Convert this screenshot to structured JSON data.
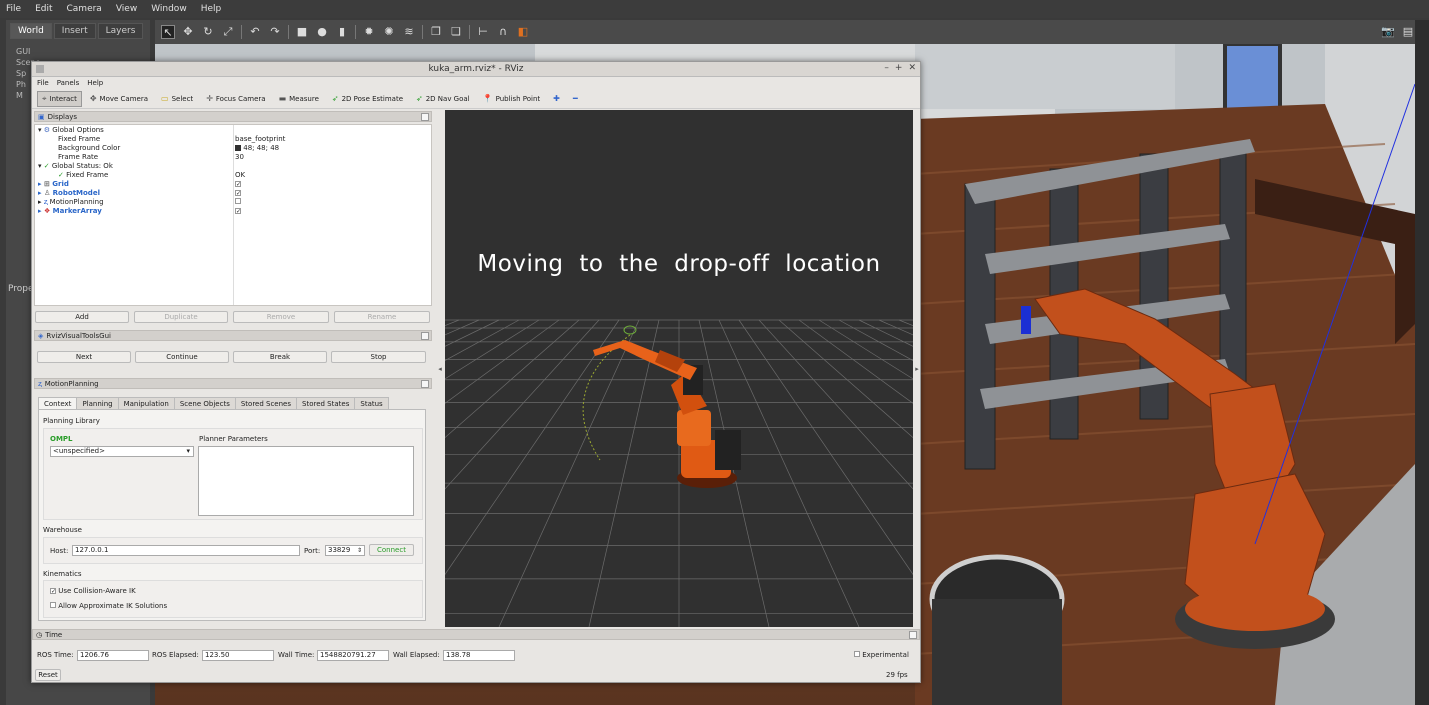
{
  "gazebo": {
    "menu": [
      "File",
      "Edit",
      "Camera",
      "View",
      "Window",
      "Help"
    ],
    "tabs": [
      "World",
      "Insert",
      "Layers"
    ],
    "tree_items": [
      "GUI",
      "Scene",
      "Sp",
      "Ph",
      "M"
    ],
    "props_label": "Prope"
  },
  "rviz": {
    "window_title": "kuka_arm.rviz* - RViz",
    "menu": [
      "File",
      "Panels",
      "Help"
    ],
    "toolbar": [
      {
        "label": "Interact",
        "icon": "interact-icon"
      },
      {
        "label": "Move Camera",
        "icon": "move-camera-icon"
      },
      {
        "label": "Select",
        "icon": "select-icon"
      },
      {
        "label": "Focus Camera",
        "icon": "focus-camera-icon"
      },
      {
        "label": "Measure",
        "icon": "measure-icon"
      },
      {
        "label": "2D Pose Estimate",
        "icon": "pose-estimate-icon"
      },
      {
        "label": "2D Nav Goal",
        "icon": "nav-goal-icon"
      },
      {
        "label": "Publish Point",
        "icon": "publish-point-icon"
      }
    ],
    "displays": {
      "title": "Displays",
      "rows": [
        {
          "label": "Global Options",
          "value": ""
        },
        {
          "label": "Fixed Frame",
          "value": "base_footprint"
        },
        {
          "label": "Background Color",
          "value": "48; 48; 48"
        },
        {
          "label": "Frame Rate",
          "value": "30"
        },
        {
          "label": "Global Status: Ok",
          "value": ""
        },
        {
          "label": "Fixed Frame",
          "value": "OK"
        },
        {
          "label": "Grid",
          "value": "✓"
        },
        {
          "label": "RobotModel",
          "value": "✓"
        },
        {
          "label": "MotionPlanning",
          "value": ""
        },
        {
          "label": "MarkerArray",
          "value": "✓"
        }
      ],
      "background_color_hex": "#303030",
      "buttons": [
        "Add",
        "Duplicate",
        "Remove",
        "Rename"
      ]
    },
    "visual_tools": {
      "title": "RvizVisualToolsGui",
      "buttons": [
        "Next",
        "Continue",
        "Break",
        "Stop"
      ]
    },
    "motion_planning": {
      "title": "MotionPlanning",
      "tabs": [
        "Context",
        "Planning",
        "Manipulation",
        "Scene Objects",
        "Stored Scenes",
        "Stored States",
        "Status"
      ],
      "planning_library_label": "Planning Library",
      "library_name": "OMPL",
      "planner_select": "<unspecified>",
      "planner_params_label": "Planner Parameters",
      "warehouse_label": "Warehouse",
      "host_label": "Host:",
      "host_value": "127.0.0.1",
      "port_label": "Port:",
      "port_value": "33829",
      "connect_label": "Connect",
      "kinematics_label": "Kinematics",
      "collision_aware_label": "Use Collision-Aware IK",
      "collision_aware_checked": true,
      "approx_ik_label": "Allow Approximate IK Solutions",
      "approx_ik_checked": false
    },
    "viewport": {
      "overlay_text": "Moving to the drop-off location"
    },
    "time": {
      "title": "Time",
      "ros_time_label": "ROS Time:",
      "ros_time": "1206.76",
      "ros_elapsed_label": "ROS Elapsed:",
      "ros_elapsed": "123.50",
      "wall_time_label": "Wall Time:",
      "wall_time": "1548820791.27",
      "wall_elapsed_label": "Wall Elapsed:",
      "wall_elapsed": "138.78",
      "experimental_label": "Experimental",
      "reset_label": "Reset",
      "fps": "29 fps"
    }
  },
  "colors": {
    "robot_orange": "#e05a14",
    "link_blue": "#2a66c8",
    "ompl_green": "#2a9d2a"
  }
}
